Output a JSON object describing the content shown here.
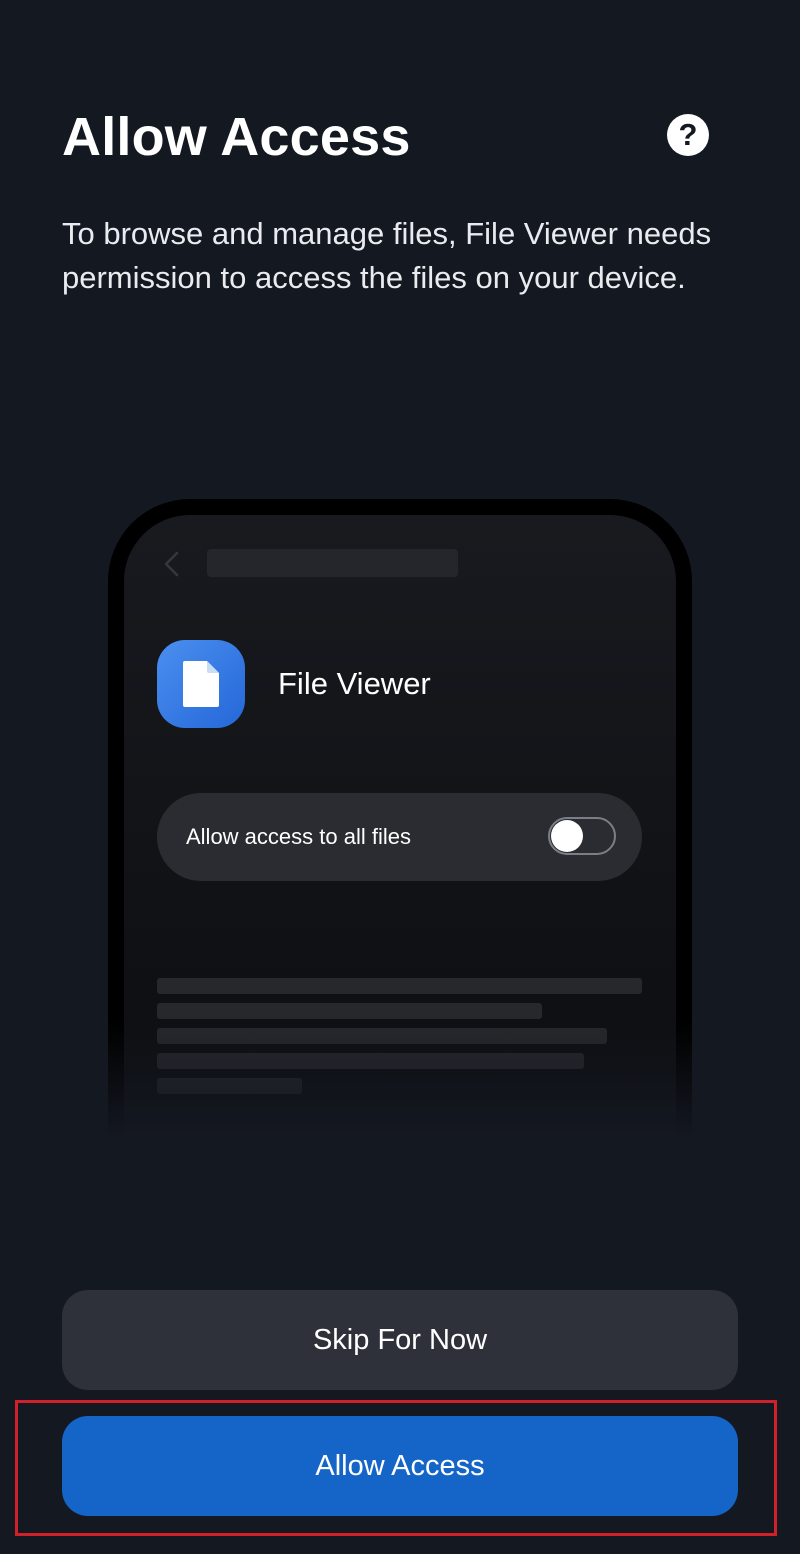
{
  "header": {
    "title": "Allow Access",
    "help_icon": "question-mark-icon",
    "help_glyph": "?"
  },
  "description": "To browse and manage files, File Viewer needs permission to access the files on your device.",
  "illustration": {
    "app_name": "File Viewer",
    "app_icon": "document-icon",
    "toggle_label": "Allow access to all files",
    "toggle_on": false
  },
  "buttons": {
    "skip_label": "Skip For Now",
    "allow_label": "Allow Access"
  },
  "colors": {
    "background": "#141821",
    "primary": "#1565c8",
    "secondary_button": "#2e3139",
    "highlight": "#d0202a"
  }
}
